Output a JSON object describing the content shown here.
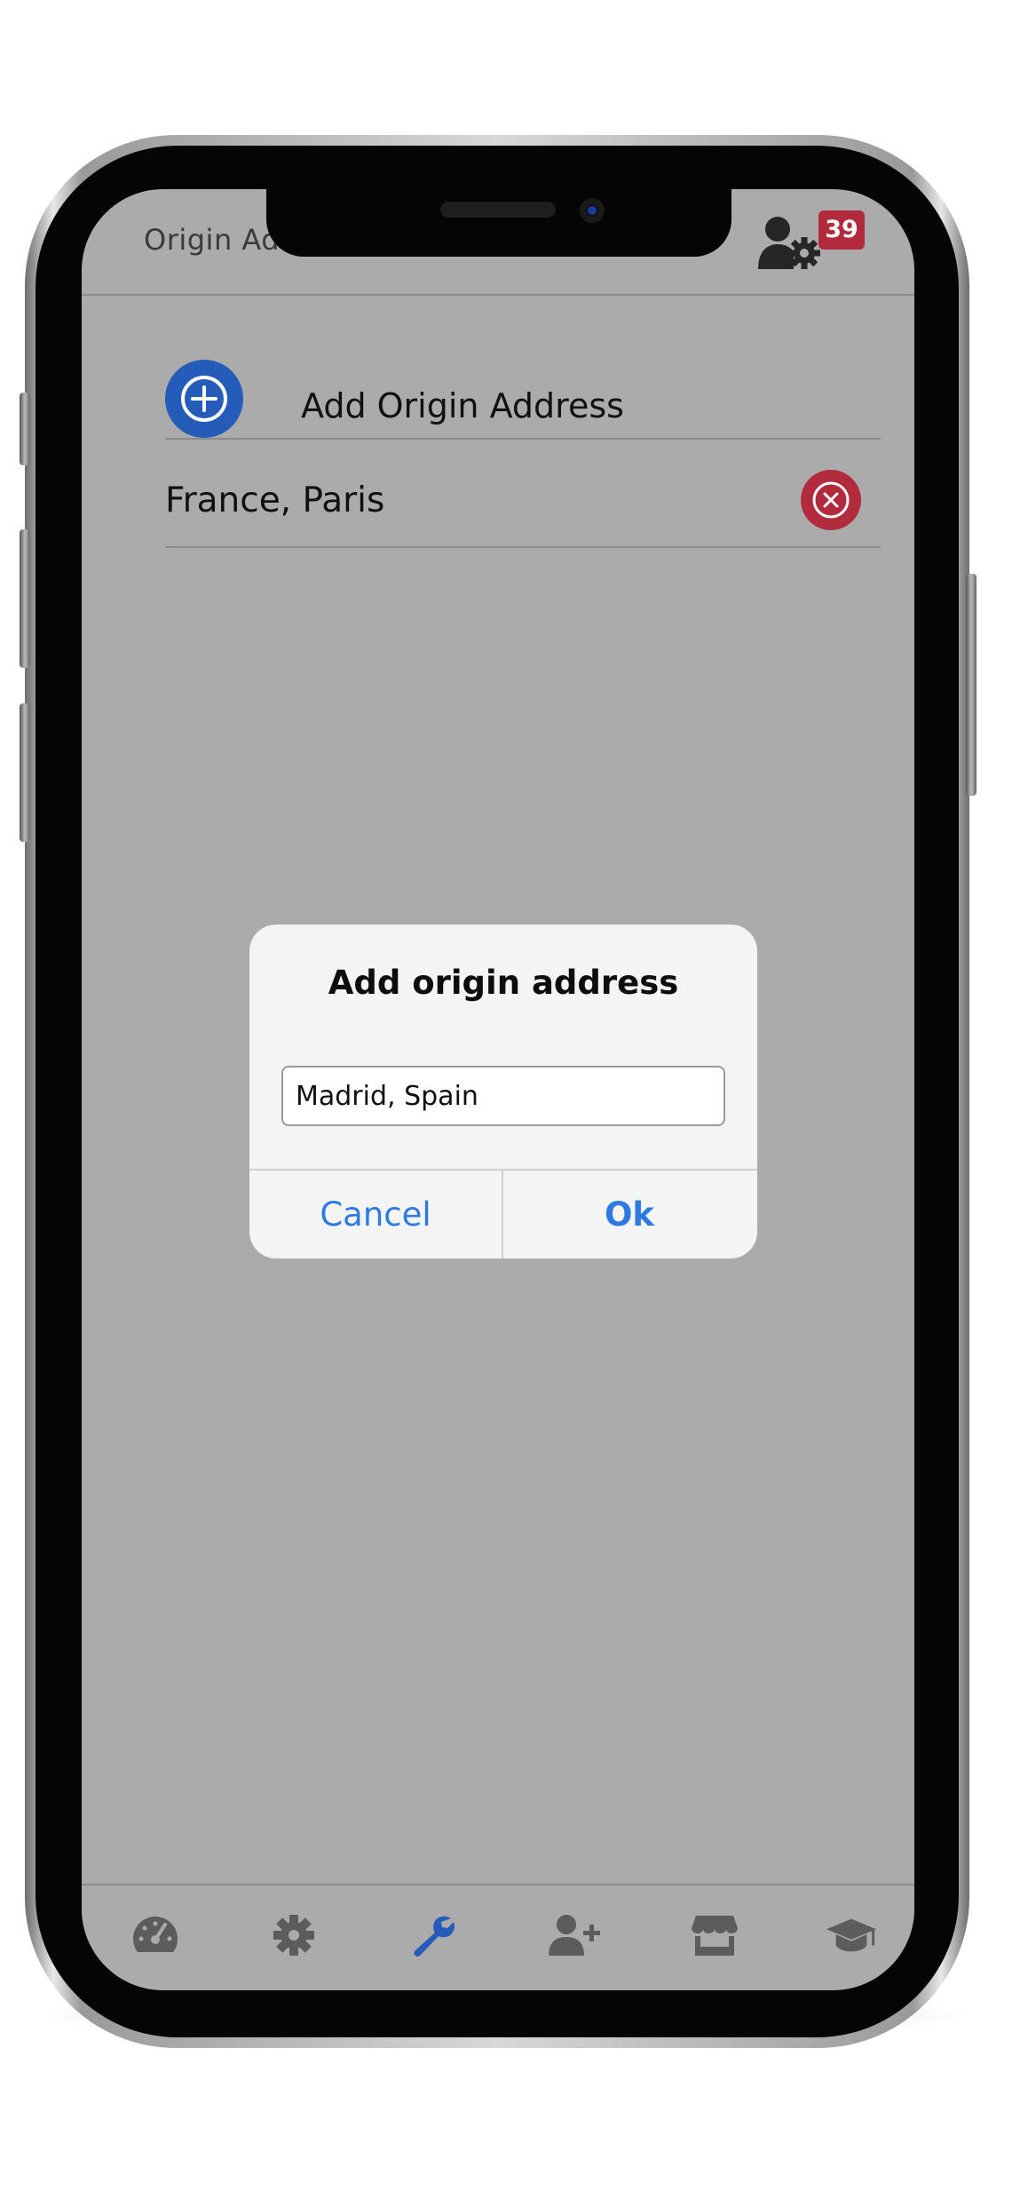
{
  "header": {
    "title": "Origin Ad",
    "notification_count": "39",
    "user_icon": "user-gear-icon"
  },
  "list": {
    "add_label": "Add Origin Address",
    "add_icon": "plus-circle-icon",
    "addresses": [
      {
        "label": "France, Paris",
        "remove_icon": "x-circle-icon"
      }
    ]
  },
  "dialog": {
    "title": "Add origin address",
    "input_value": "Madrid, Spain",
    "cancel_label": "Cancel",
    "ok_label": "Ok"
  },
  "tabbar": {
    "items": [
      {
        "icon": "speedometer-icon",
        "active": false
      },
      {
        "icon": "gear-icon",
        "active": false
      },
      {
        "icon": "wrench-icon",
        "active": true
      },
      {
        "icon": "add-user-icon",
        "active": false
      },
      {
        "icon": "store-icon",
        "active": false
      },
      {
        "icon": "graduation-cap-icon",
        "active": false
      }
    ]
  },
  "colors": {
    "accent_blue": "#255cb9",
    "danger_red": "#b22b3c",
    "link_blue": "#2d7be0",
    "screen_dim": "#ababab",
    "inactive_icon": "#5c5c5c"
  }
}
